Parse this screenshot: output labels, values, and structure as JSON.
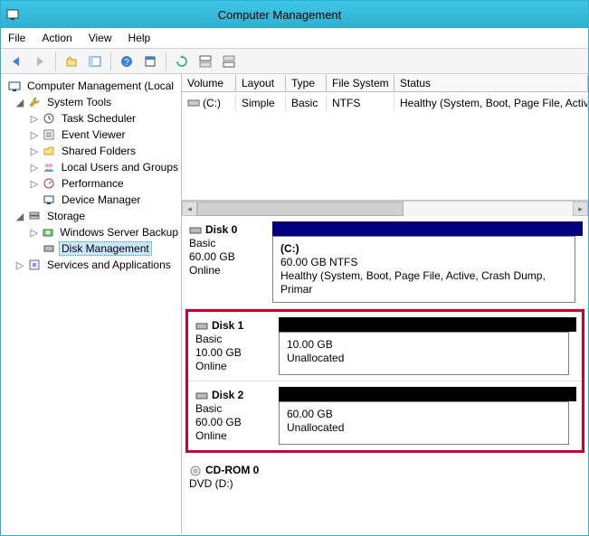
{
  "window": {
    "title": "Computer Management"
  },
  "menu": {
    "file": "File",
    "action": "Action",
    "view": "View",
    "help": "Help"
  },
  "tree": {
    "root": "Computer Management (Local",
    "system_tools": "System Tools",
    "task_scheduler": "Task Scheduler",
    "event_viewer": "Event Viewer",
    "shared_folders": "Shared Folders",
    "local_users": "Local Users and Groups",
    "performance": "Performance",
    "device_manager": "Device Manager",
    "storage": "Storage",
    "ws_backup": "Windows Server Backup",
    "disk_mgmt": "Disk Management",
    "services_apps": "Services and Applications"
  },
  "volcols": {
    "volume": "Volume",
    "layout": "Layout",
    "type": "Type",
    "fs": "File System",
    "status": "Status"
  },
  "volrow": {
    "volume": "(C:)",
    "layout": "Simple",
    "type": "Basic",
    "fs": "NTFS",
    "status": "Healthy (System, Boot, Page File, Active, Cra"
  },
  "disks": {
    "d0": {
      "name": "Disk 0",
      "type": "Basic",
      "size": "60.00 GB",
      "state": "Online",
      "part": {
        "name": "(C:)",
        "size": "60.00 GB NTFS",
        "status": "Healthy (System, Boot, Page File, Active, Crash Dump, Primar"
      }
    },
    "d1": {
      "name": "Disk 1",
      "type": "Basic",
      "size": "10.00 GB",
      "state": "Online",
      "part": {
        "name": "",
        "size": "10.00 GB",
        "status": "Unallocated"
      }
    },
    "d2": {
      "name": "Disk 2",
      "type": "Basic",
      "size": "60.00 GB",
      "state": "Online",
      "part": {
        "name": "",
        "size": "60.00 GB",
        "status": "Unallocated"
      }
    },
    "cd": {
      "name": "CD-ROM 0",
      "sub": "DVD (D:)"
    }
  }
}
